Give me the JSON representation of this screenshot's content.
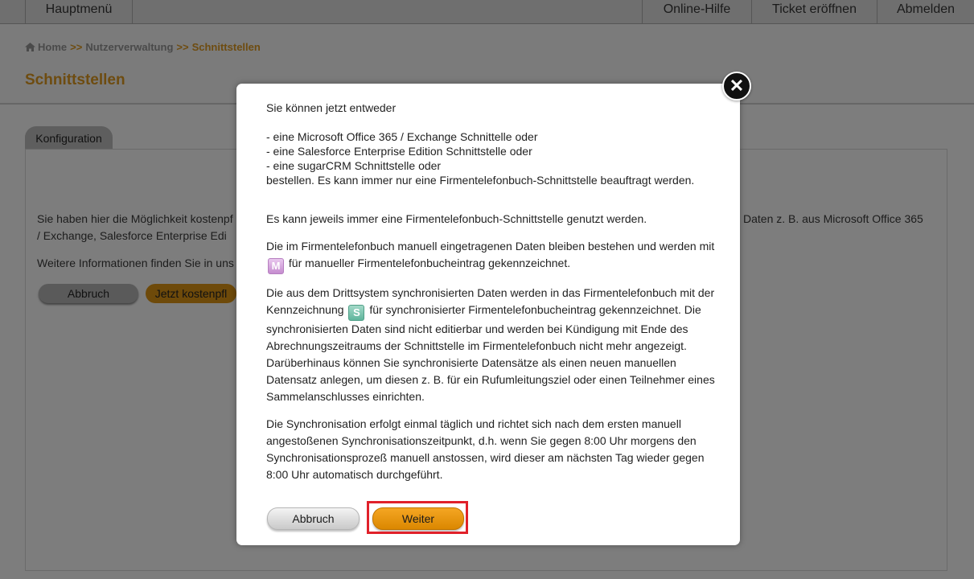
{
  "topnav": {
    "main_menu": "Hauptmenü",
    "online_help": "Online-Hilfe",
    "open_ticket": "Ticket eröffnen",
    "logout": "Abmelden"
  },
  "breadcrumb": {
    "home": "Home",
    "separator": ">>",
    "users": "Nutzerverwaltung",
    "current": "Schnittstellen"
  },
  "page": {
    "title": "Schnittstellen",
    "tab": "Konfiguration",
    "text_line1_left": "Sie haben hier die Möglichkeit kostenpf",
    "text_line1_right": "Daten z. B. aus Microsoft Office 365",
    "text_line2_left": "/ Exchange, Salesforce Enterprise Edi",
    "text_line3_left": "Weitere Informationen finden Sie in uns",
    "cancel_label": "Abbruch",
    "order_label": "Jetzt kostenpfl"
  },
  "modal": {
    "intro": "Sie können jetzt entweder",
    "options": [
      "- eine Microsoft Office 365 / Exchange Schnittelle oder",
      "- eine Salesforce Enterprise Edition Schnittstelle oder",
      "- eine sugarCRM Schnittstelle oder"
    ],
    "order_note": "bestellen. Es kann immer nur eine Firmentelefonbuch-Schnittstelle beauftragt werden.",
    "single_interface": "Es kann jeweils immer eine Firmentelefonbuch-Schnittstelle genutzt werden.",
    "manual_p1": "Die im Firmentelefonbuch manuell eingetragenen Daten bleiben bestehen und werden mit",
    "manual_badge": "M",
    "manual_p2": "für manueller Firmentelefonbucheintrag gekennzeichnet.",
    "sync_p1": "Die aus dem Drittsystem synchronisierten Daten werden in das Firmentelefonbuch mit der Kennzeichnung",
    "sync_badge": "S",
    "sync_p2": "für synchronisierter Firmentelefonbucheintrag gekennzeichnet. Die synchronisierten Daten sind nicht editierbar und werden bei Kündigung mit Ende des Abrechnungszeitraums der Schnittstelle im Firmentelefonbuch nicht mehr angezeigt. Darüberhinaus können Sie synchronisierte Datensätze als einen neuen manuellen Datensatz anlegen, um diesen z. B. für ein Rufumleitungsziel oder einen Teilnehmer eines Sammelanschlusses einrichten.",
    "schedule": "Die Synchronisation erfolgt einmal täglich und richtet sich nach dem ersten manuell angestoßenen Synchronisationszeitpunkt, d.h. wenn Sie gegen 8:00 Uhr morgens den Synchronisationsprozeß manuell anstossen, wird dieser am nächsten Tag wieder gegen 8:00 Uhr automatisch durchgeführt.",
    "cancel_label": "Abbruch",
    "next_label": "Weiter"
  },
  "colors": {
    "accent_orange": "#f5a623",
    "highlight_red": "#e0212a",
    "badge_manual": "#c58ccf",
    "badge_sync": "#5fb59c"
  },
  "icons": {
    "home": "home-icon",
    "close": "close-icon"
  }
}
